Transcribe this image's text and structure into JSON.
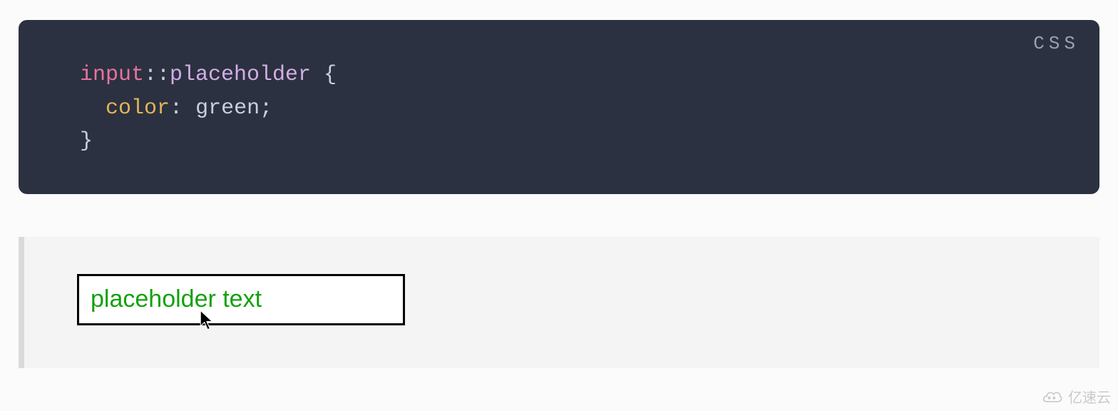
{
  "code": {
    "language_label": "CSS",
    "selector_tag": "input",
    "selector_op": "::",
    "selector_pseudo": "placeholder",
    "brace_open": "{",
    "property": "color",
    "colon": ":",
    "value": "green",
    "semicolon": ";",
    "brace_close": "}"
  },
  "demo": {
    "placeholder_text": "placeholder text",
    "placeholder_color": "#13a10e"
  },
  "watermark": {
    "text": "亿速云"
  }
}
